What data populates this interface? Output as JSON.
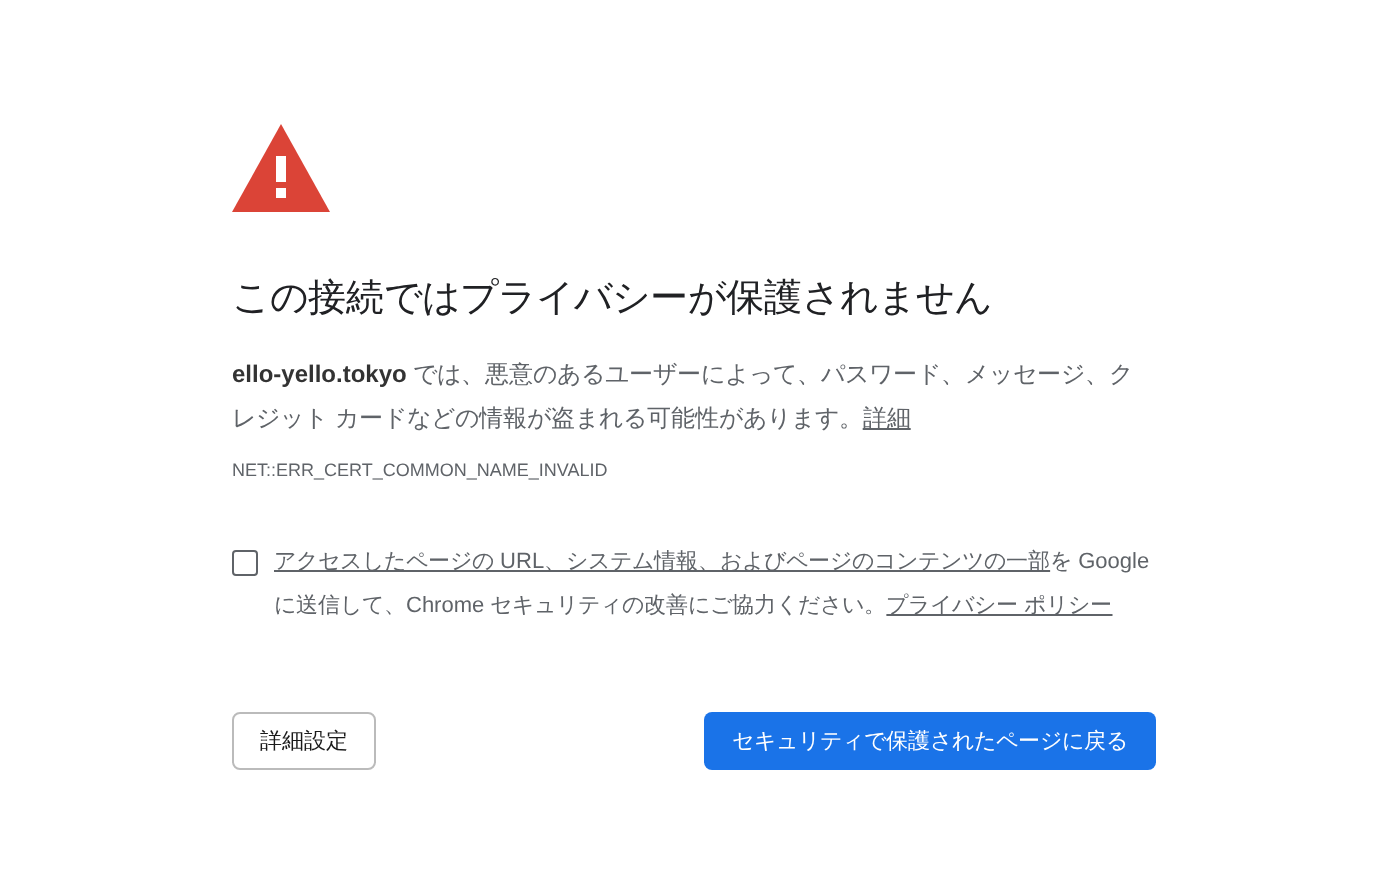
{
  "heading": "この接続ではプライバシーが保護されません",
  "message": {
    "host": "ello-yello.tokyo",
    "text": " では、悪意のあるユーザーによって、パスワード、メッセージ、クレジット カードなどの情報が盗まれる可能性があります。",
    "link": "詳細"
  },
  "error_code": "NET::ERR_CERT_COMMON_NAME_INVALID",
  "opt_in": {
    "checked": false,
    "parts": [
      {
        "kind": "link",
        "text": "アクセスしたページの URL、システム情報、およびページのコンテンツの一部"
      },
      {
        "kind": "plain",
        "text": "を Google に送信して、Chrome セキュリティの改善にご協力ください。"
      },
      {
        "kind": "link",
        "text": "プライバシー ポリシー"
      }
    ]
  },
  "buttons": {
    "advanced": "詳細設定",
    "back": "セキュリティで保護されたページに戻る"
  }
}
